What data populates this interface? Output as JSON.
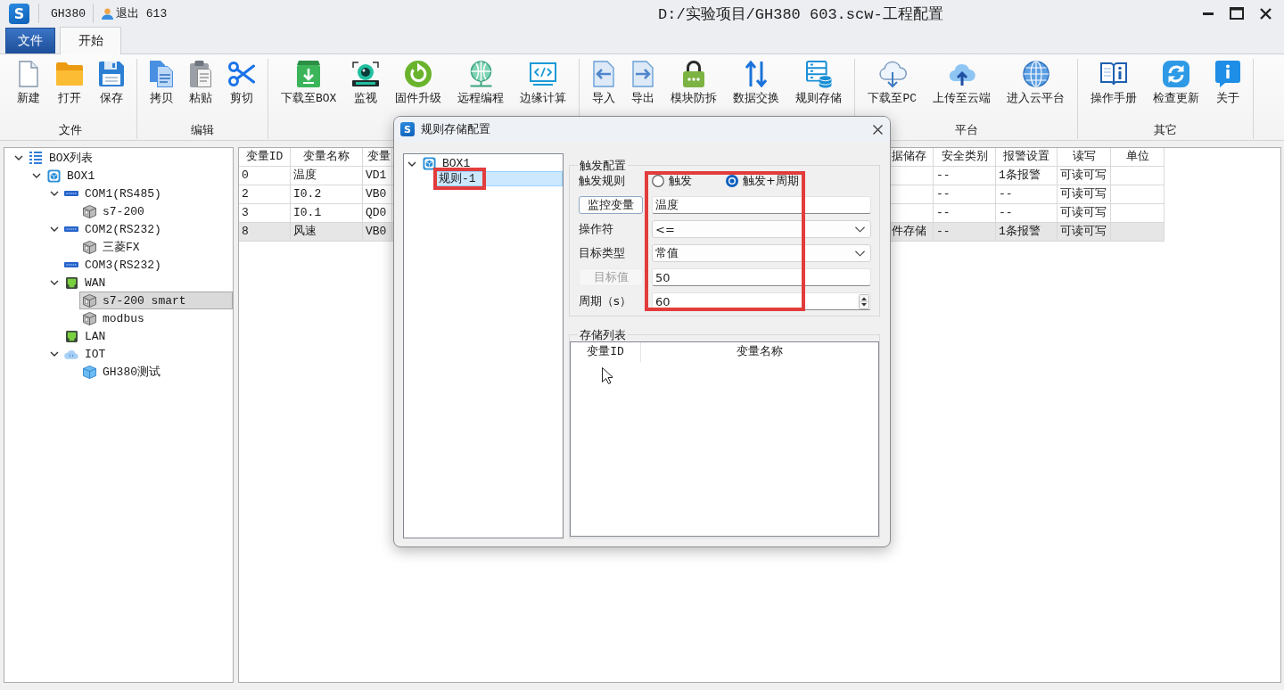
{
  "window": {
    "logo": "S",
    "project": "GH380",
    "user": "退出 613",
    "title": "D:/实验项目/GH380 603.scw-工程配置"
  },
  "tabs": [
    {
      "label": "文件",
      "kind": "menu",
      "selected": false
    },
    {
      "label": "开始",
      "kind": "tab",
      "selected": true
    }
  ],
  "ribbon": {
    "groups": [
      {
        "label": "文件",
        "buttons": [
          "新建",
          "打开",
          "保存"
        ]
      },
      {
        "label": "编辑",
        "buttons": [
          "拷贝",
          "粘贴",
          "剪切"
        ]
      },
      {
        "buttons": [
          "下载至BOX",
          "监视",
          "固件升级",
          "远程编程",
          "边缘计算"
        ]
      },
      {
        "buttons": [
          "导入",
          "导出",
          "模块防拆",
          "数据交换",
          "规则存储"
        ]
      },
      {
        "label": "平台",
        "buttons": [
          "下载至PC",
          "上传至云端",
          "进入云平台"
        ]
      },
      {
        "label": "其它",
        "buttons": [
          "操作手册",
          "检查更新",
          "关于"
        ]
      }
    ]
  },
  "box_tree": [
    {
      "label": "BOX列表",
      "kind": "list",
      "expanded": true,
      "selected": false,
      "children": [
        {
          "label": "BOX1",
          "kind": "box",
          "expanded": true,
          "selected": false,
          "children": [
            {
              "label": "COM1(RS485)",
              "kind": "port",
              "expanded": true,
              "selected": false,
              "children": [
                {
                  "label": "s7-200",
                  "kind": "device",
                  "selected": false
                }
              ]
            },
            {
              "label": "COM2(RS232)",
              "kind": "port",
              "expanded": true,
              "selected": false,
              "children": [
                {
                  "label": "三菱FX",
                  "kind": "device",
                  "selected": false
                }
              ]
            },
            {
              "label": "COM3(RS232)",
              "kind": "port",
              "selected": false
            },
            {
              "label": "WAN",
              "kind": "network",
              "expanded": true,
              "selected": false,
              "children": [
                {
                  "label": "s7-200 smart",
                  "kind": "device",
                  "selected": true
                },
                {
                  "label": "modbus",
                  "kind": "device",
                  "selected": false
                }
              ]
            },
            {
              "label": "LAN",
              "kind": "network",
              "selected": false
            },
            {
              "label": "IOT",
              "kind": "cloud",
              "expanded": true,
              "selected": false,
              "children": [
                {
                  "label": "GH380测试",
                  "kind": "gateway",
                  "selected": false
                }
              ]
            }
          ]
        }
      ]
    }
  ],
  "variable_table": {
    "columns": [
      "变量ID",
      "变量名称",
      "变量",
      "据储存",
      "安全类别",
      "报警设置",
      "读写",
      "单位"
    ],
    "rows": [
      {
        "selected": false,
        "cells": [
          "0",
          "温度",
          "VD1",
          null,
          "--",
          "1条报警",
          "可读可写",
          null
        ]
      },
      {
        "selected": false,
        "cells": [
          "2",
          "I0.2",
          "VB0",
          null,
          "--",
          "--",
          "可读可写",
          null
        ]
      },
      {
        "selected": false,
        "cells": [
          "3",
          "I0.1",
          "QD0",
          null,
          "--",
          "--",
          "可读可写",
          null
        ]
      },
      {
        "selected": true,
        "cells": [
          "8",
          "风速",
          "VB0",
          "件存储",
          "--",
          "1条报警",
          "可读可写",
          null
        ]
      }
    ]
  },
  "dialog": {
    "logo": "S",
    "title": "规则存储配置",
    "tree": [
      {
        "label": "BOX1",
        "kind": "box",
        "expanded": true,
        "selected": false,
        "highlighted": false,
        "children": [
          {
            "label": "规则-1",
            "selected": true,
            "highlighted": true
          }
        ]
      }
    ],
    "trigger_config": {
      "title": "触发配置",
      "values_highlighted": true,
      "rule": {
        "label": "触发规则",
        "options": [
          {
            "label": "触发",
            "selected": false
          },
          {
            "label": "触发+周期",
            "selected": true
          }
        ]
      },
      "fields": [
        {
          "label": {
            "text": "监控变量",
            "kind": "button",
            "disabled": false
          },
          "control": {
            "kind": "input",
            "value": "温度"
          }
        },
        {
          "label": {
            "text": "操作符",
            "kind": "text",
            "disabled": false
          },
          "control": {
            "kind": "select",
            "value": "<="
          }
        },
        {
          "label": {
            "text": "目标类型",
            "kind": "text",
            "disabled": false
          },
          "control": {
            "kind": "select",
            "value": "常值"
          }
        },
        {
          "label": {
            "text": "目标值",
            "kind": "button",
            "disabled": true
          },
          "control": {
            "kind": "input",
            "value": "50"
          }
        },
        {
          "label": {
            "text": "周期（s）",
            "kind": "text",
            "disabled": false
          },
          "control": {
            "kind": "spin",
            "value": "60"
          }
        }
      ]
    },
    "storage_list": {
      "title": "存储列表",
      "columns": [
        "变量ID",
        "变量名称"
      ]
    }
  }
}
